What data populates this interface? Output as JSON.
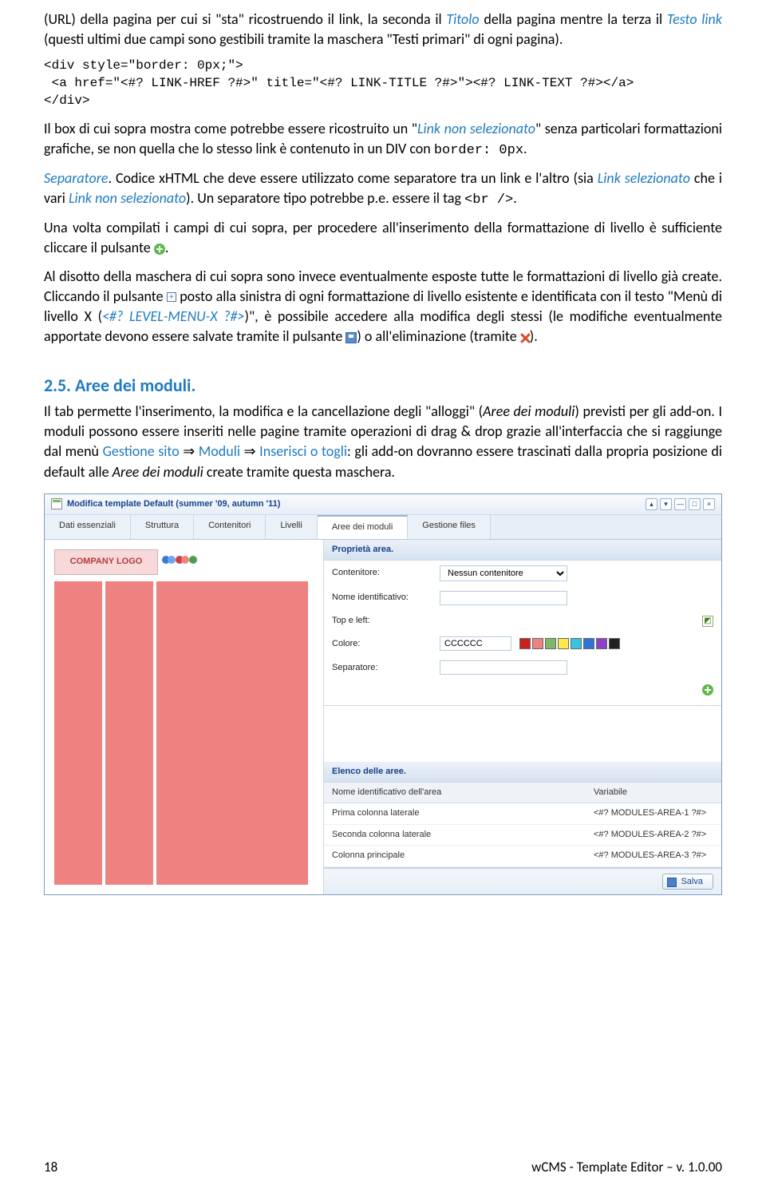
{
  "para1": {
    "before_titolo": "(URL) della pagina per cui si \"sta\" ricostruendo il link, la seconda il ",
    "titolo": "Titolo",
    "after_titolo": " della pagina mentre la terza il ",
    "testo_link": "Testo link",
    "after_testo": " (questi ultimi due campi sono gestibili tramite la maschera \"Testi primari\" di ogni pagina)."
  },
  "code_block": "<div style=\"border: 0px;\">\n <a href=\"<#? LINK-HREF ?#>\" title=\"<#? LINK-TITLE ?#>\"><#? LINK-TEXT ?#></a>\n</div>",
  "para2": {
    "before": "Il box di cui sopra mostra come potrebbe essere ricostruito un \"",
    "link_non_sel": "Link non selezionato",
    "after": "\" senza particolari formattazioni grafiche, se non quella che lo stesso link è contenuto in un DIV con ",
    "code": "border: 0px",
    "tail": "."
  },
  "para3": {
    "sep": "Separatore",
    "a": ". Codice xHTML che deve essere utilizzato come separatore tra un link e l'altro (sia ",
    "link_sel": "Link selezionato",
    "b": " che i vari ",
    "link_non_sel": "Link non selezionato",
    "c": "). Un separatore tipo potrebbe p.e. essere il tag ",
    "br": "<br />",
    "d": "."
  },
  "para4": "Una volta compilati i campi di cui sopra, per procedere all'inserimento della formattazione di livello è sufficiente cliccare il pulsante ",
  "para4_tail": ".",
  "para5": {
    "a": "Al disotto della maschera di cui sopra sono invece eventualmente esposte tutte le formattazioni di livello già create. Cliccando il pulsante ",
    "b": " posto alla sinistra di ogni formattazione di livello esistente e identificata con il testo \"Menù di livello X (",
    "level_menu": "<#? LEVEL-MENU-X ?#>",
    "c": ")\", è possibile accedere alla modifica degli stessi (le modifiche eventualmente apportate devono essere salvate tramite il pulsante ",
    "d": ") o all'eliminazione (tramite ",
    "e": ")."
  },
  "section_header": "2.5. Aree dei moduli.",
  "para6": {
    "a": "Il tab permette l'inserimento, la modifica e la cancellazione degli \"alloggi\" (",
    "aree": "Aree dei moduli",
    "b": ") previsti per gli add-on. I moduli possono essere inseriti nelle pagine tramite operazioni di drag & drop grazie all'interfaccia che si raggiunge dal menù ",
    "bc1": "Gestione sito",
    "arrow1": " ⇒ ",
    "bc2": "Moduli",
    "arrow2": " ⇒ ",
    "bc3": "Inserisci o togli",
    "c": ": gli add-on dovranno essere trascinati dalla propria posizione di default alle ",
    "aree2": "Aree dei moduli",
    "d": " create tramite questa maschera."
  },
  "window": {
    "title": "Modifica template Default (summer '09, autumn '11)",
    "tabs": [
      "Dati essenziali",
      "Struttura",
      "Contenitori",
      "Livelli",
      "Aree dei moduli",
      "Gestione files"
    ],
    "active_tab": 4,
    "logo": "COMPANY LOGO",
    "prop_header": "Proprietà area.",
    "fields": {
      "contenitore_label": "Contenitore:",
      "contenitore_value": "Nessun contenitore",
      "nome_label": "Nome identificativo:",
      "topleft_label": "Top e left:",
      "colore_label": "Colore:",
      "colore_value": "CCCCCC",
      "separatore_label": "Separatore:"
    },
    "swatches": [
      "#CC2020",
      "#F08181",
      "#7FB86B",
      "#FFE84A",
      "#38C4E0",
      "#2D74D6",
      "#9040C8",
      "#222222"
    ],
    "list_header": "Elenco delle aree.",
    "col_name": "Nome identificativo dell'area",
    "col_var": "Variabile",
    "rows": [
      {
        "name": "Prima colonna laterale",
        "var": "<#? MODULES-AREA-1 ?#>"
      },
      {
        "name": "Seconda colonna laterale",
        "var": "<#? MODULES-AREA-2 ?#>"
      },
      {
        "name": "Colonna principale",
        "var": "<#? MODULES-AREA-3 ?#>"
      }
    ],
    "save": "Salva"
  },
  "footer": {
    "page": "18",
    "doc": "wCMS - Template Editor – v. 1.0.00"
  }
}
